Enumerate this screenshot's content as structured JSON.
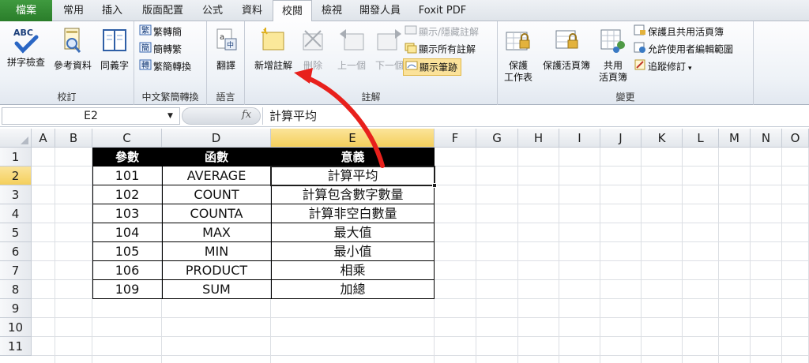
{
  "tabs": [
    {
      "id": "file",
      "label": "檔案"
    },
    {
      "id": "home",
      "label": "常用"
    },
    {
      "id": "insert",
      "label": "插入"
    },
    {
      "id": "layout",
      "label": "版面配置"
    },
    {
      "id": "formulas",
      "label": "公式"
    },
    {
      "id": "data",
      "label": "資料"
    },
    {
      "id": "review",
      "label": "校閱",
      "active": true
    },
    {
      "id": "view",
      "label": "檢視"
    },
    {
      "id": "developer",
      "label": "開發人員"
    },
    {
      "id": "foxit",
      "label": "Foxit PDF"
    }
  ],
  "ribbon": {
    "proofing": {
      "label": "校訂",
      "spelling": "拼字檢查",
      "spelling_icon_text": "ABC",
      "research": "參考資料",
      "thesaurus": "同義字"
    },
    "chinese": {
      "label": "中文繁簡轉換",
      "to_simplified": "繁轉簡",
      "to_traditional": "簡轉繁",
      "convert": "繁簡轉換"
    },
    "language": {
      "label": "語言",
      "translate": "翻譯"
    },
    "comments": {
      "label": "註解",
      "new_comment": "新增註解",
      "delete": "刪除",
      "previous": "上一個",
      "next": "下一個",
      "show_hide": "顯示/隱藏註解",
      "show_all": "顯示所有註解",
      "show_ink": "顯示筆跡"
    },
    "changes": {
      "label": "變更",
      "protect_sheet_l1": "保護",
      "protect_sheet_l2": "工作表",
      "protect_workbook": "保護活頁簿",
      "share_l1": "共用",
      "share_l2": "活頁簿",
      "protect_share": "保護且共用活頁簿",
      "allow_edit": "允許使用者編輯範圍",
      "track_changes": "追蹤修訂"
    }
  },
  "formula_bar": {
    "name_box": "E2",
    "fx_label": "fx",
    "formula": "計算平均"
  },
  "columns": [
    "A",
    "B",
    "C",
    "D",
    "E",
    "F",
    "G",
    "H",
    "I",
    "J",
    "K",
    "L",
    "M",
    "N",
    "O"
  ],
  "selected_column": "E",
  "rows": [
    "1",
    "2",
    "3",
    "4",
    "5",
    "6",
    "7",
    "8",
    "9",
    "10",
    "11"
  ],
  "selected_row": "2",
  "table": {
    "headers": [
      "參數",
      "函數",
      "意義"
    ],
    "rows": [
      [
        "101",
        "AVERAGE",
        "計算平均"
      ],
      [
        "102",
        "COUNT",
        "計算包含數字數量"
      ],
      [
        "103",
        "COUNTA",
        "計算非空白數量"
      ],
      [
        "104",
        "MAX",
        "最大值"
      ],
      [
        "105",
        "MIN",
        "最小值"
      ],
      [
        "106",
        "PRODUCT",
        "相乘"
      ],
      [
        "109",
        "SUM",
        "加總"
      ]
    ]
  },
  "colors": {
    "file_tab": "#2f8a2f",
    "selected_header": "#f6d46b",
    "table_header_bg": "#000000",
    "annotation_arrow": "#e8201c"
  }
}
